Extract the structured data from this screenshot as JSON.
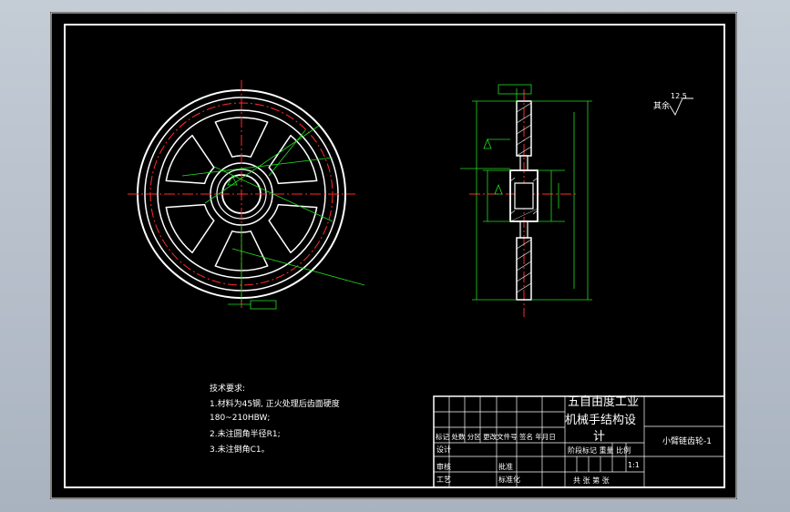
{
  "drawing": {
    "title_part": "小臂链齿轮-1",
    "school_line1": "五自由度工业",
    "school_line2": "机械手结构设",
    "school_line3": "计",
    "tech_req_title": "技术要求:",
    "tech_req_1": "1.材料为45钢, 正火处理后齿面硬度",
    "tech_req_1b": "180~210HBW;",
    "tech_req_2": "2.未注圆角半径R1;",
    "tech_req_3": "3.未注倒角C1。",
    "roughness_label": "其余",
    "roughness_value": "12.5",
    "scale": "1:1",
    "tb_header": "标记 处数 分区 更改文件号 签名 年月日",
    "tb_design": "设计",
    "tb_standard": "标准化",
    "tb_review": "审核",
    "tb_process": "工艺",
    "tb_approve": "批准",
    "tb_stage_header": "阶段标记 重量 比例",
    "tb_sheets": "共 张 第 张"
  },
  "colors": {
    "sheet_bg": "#000000",
    "outline": "#ffffff",
    "centerline": "#ff2a2a",
    "dimension": "#22dd22",
    "hatch": "#ffffff"
  }
}
